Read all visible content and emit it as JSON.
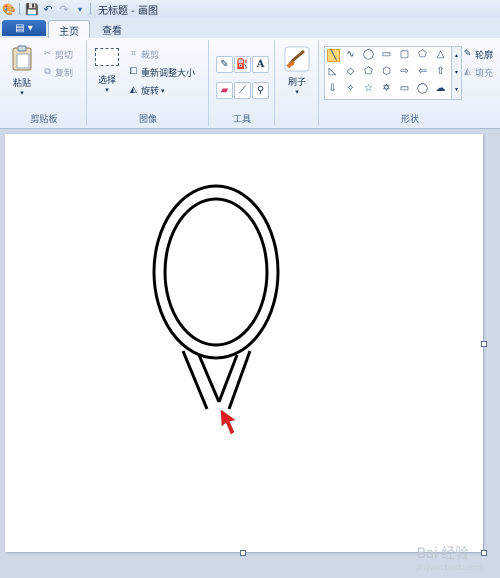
{
  "title_bar": {
    "title": "无标题 - 画图",
    "icons": [
      "paint-app-icon",
      "save-icon",
      "undo-icon",
      "redo-icon",
      "customize-qat-icon"
    ]
  },
  "tabs": {
    "file": "▤ ▾",
    "home": "主页",
    "view": "查看"
  },
  "clipboard": {
    "paste": "粘贴",
    "cut": "剪切",
    "copy": "复制",
    "label": "剪贴板"
  },
  "image": {
    "select": "选择",
    "crop": "裁剪",
    "resize": "重新调整大小",
    "rotate": "旋转",
    "label": "图像"
  },
  "tools": {
    "label": "工具",
    "text_glyph": "A"
  },
  "brushes": {
    "label": "刷子"
  },
  "shapes": {
    "outline": "轮廓",
    "fill": "填充",
    "label": "形状"
  },
  "watermark": {
    "text": "Bai 经验",
    "sub": "jingyan.baidu.com"
  },
  "colors": {
    "accent": "#1f56a6",
    "arrow": "#e02020",
    "stroke": "#000000"
  }
}
